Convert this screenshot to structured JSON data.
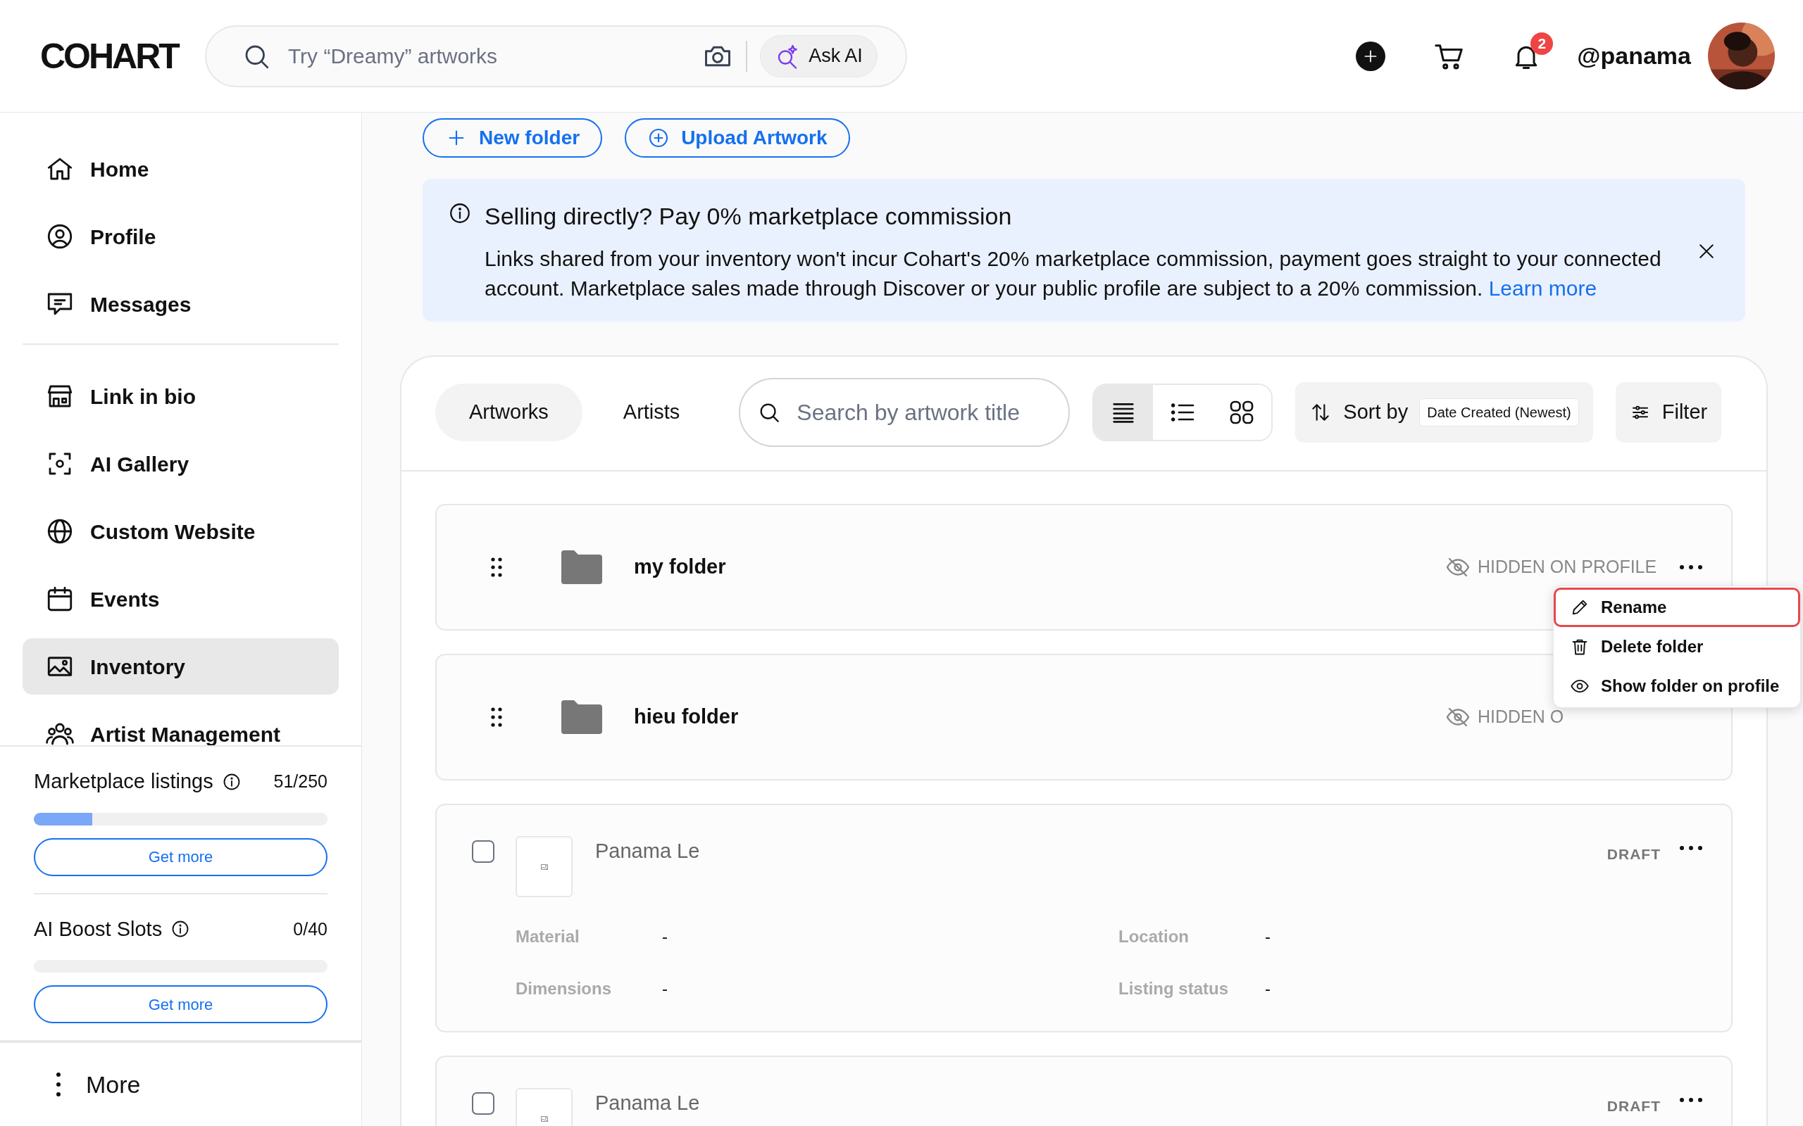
{
  "header": {
    "logo": "COHART",
    "search": {
      "placeholder": "Try “Dreamy” artworks"
    },
    "ask_ai": "Ask AI",
    "notification_count": "2",
    "username": "@panama"
  },
  "sidebar": {
    "nav_groups": [
      [
        {
          "label": "Home",
          "selected": false
        },
        {
          "label": "Profile",
          "selected": false
        },
        {
          "label": "Messages",
          "selected": false
        }
      ],
      [
        {
          "label": "Link in bio",
          "selected": false
        },
        {
          "label": "AI Gallery",
          "selected": false
        },
        {
          "label": "Custom Website",
          "selected": false
        },
        {
          "label": "Events",
          "selected": false
        },
        {
          "label": "Inventory",
          "selected": true
        },
        {
          "label": "Artist Management",
          "selected": false
        }
      ]
    ],
    "quotas": [
      {
        "label": "Marketplace listings",
        "count": "51/250",
        "level": 0.2,
        "button": "Get more"
      },
      {
        "label": "AI Boost Slots",
        "count": "0/40",
        "level": 0,
        "button": "Get more"
      }
    ],
    "more": "More"
  },
  "actions": [
    "New folder",
    "Upload Artwork"
  ],
  "banner": {
    "title": "Selling directly? Pay 0% marketplace commission",
    "body": "Links shared from your inventory won't incur Cohart's 20% marketplace commission, payment goes straight to your connected account. Marketplace sales made through Discover or your public profile are subject to a 20% commission.",
    "link": "Learn more"
  },
  "toolbar": {
    "tabs": [
      {
        "label": "Artworks",
        "selected": true
      },
      {
        "label": "Artists",
        "selected": false
      }
    ],
    "search": {
      "placeholder": "Search by artwork title"
    },
    "views": [
      {
        "selected": true
      },
      {
        "selected": false
      },
      {
        "selected": false
      }
    ],
    "sort": {
      "label": "Sort by",
      "value": "Date Created (Newest)"
    },
    "filter": "Filter"
  },
  "folders": [
    {
      "name": "my folder",
      "visibility": "HIDDEN ON PROFILE",
      "menu": [
        {
          "label": "Rename",
          "selected": true
        },
        {
          "label": "Delete folder",
          "selected": false
        },
        {
          "label": "Show folder on profile",
          "selected": false
        }
      ]
    },
    {
      "name": "hieu folder",
      "visibility": "HIDDEN O"
    }
  ],
  "artworks": [
    {
      "title": "Panama Le",
      "status": "DRAFT",
      "checked": false,
      "fields": [
        {
          "label": "Material",
          "value": "-"
        },
        {
          "label": "Location",
          "value": "-"
        },
        {
          "label": "Dimensions",
          "value": "-"
        },
        {
          "label": "Listing status",
          "value": "-"
        }
      ]
    },
    {
      "title": "Panama Le",
      "status": "DRAFT",
      "checked": false
    }
  ]
}
